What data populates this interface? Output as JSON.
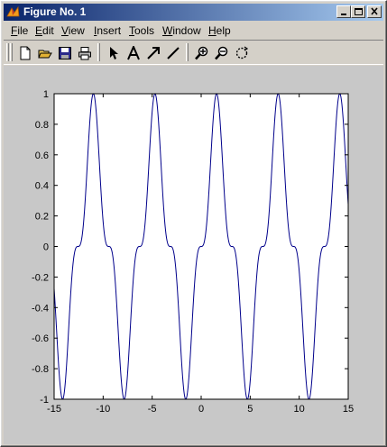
{
  "window": {
    "title": "Figure No. 1"
  },
  "menubar": {
    "items": [
      {
        "label": "File",
        "accel": "F",
        "rest": "ile"
      },
      {
        "label": "Edit",
        "accel": "E",
        "rest": "dit"
      },
      {
        "label": "View",
        "accel": "V",
        "rest": "iew"
      },
      {
        "label": "Insert",
        "accel": "I",
        "rest": "nsert"
      },
      {
        "label": "Tools",
        "accel": "T",
        "rest": "ools"
      },
      {
        "label": "Window",
        "accel": "W",
        "rest": "indow"
      },
      {
        "label": "Help",
        "accel": "H",
        "rest": "elp"
      }
    ]
  },
  "toolbar": {
    "icons": [
      "new-file-icon",
      "open-file-icon",
      "save-icon",
      "print-icon",
      "select-arrow-icon",
      "insert-text-icon",
      "insert-arrow-icon",
      "insert-line-icon",
      "zoom-in-icon",
      "zoom-out-icon",
      "rotate-3d-icon"
    ]
  },
  "chart_data": {
    "type": "line",
    "title": "",
    "xlabel": "",
    "ylabel": "",
    "xlim": [
      -15,
      15
    ],
    "ylim": [
      -1,
      1
    ],
    "xticks": [
      -15,
      -10,
      -5,
      0,
      5,
      10,
      15
    ],
    "yticks": [
      -1,
      -0.8,
      -0.6,
      -0.4,
      -0.2,
      0,
      0.2,
      0.4,
      0.6,
      0.8,
      1
    ],
    "grid": false,
    "series": [
      {
        "function": "y = sin(x)^3",
        "color": "#00008b"
      }
    ]
  }
}
